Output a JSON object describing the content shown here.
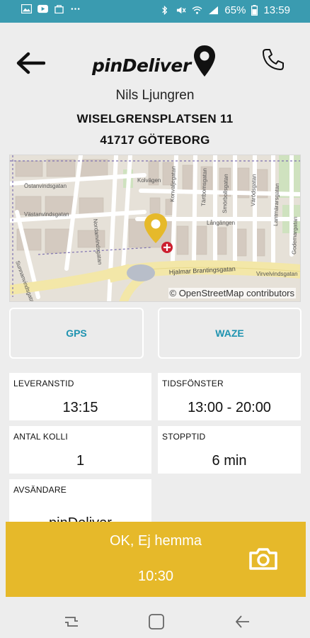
{
  "status_bar": {
    "battery": "65%",
    "time": "13:59",
    "background_color": "#3a9bb0",
    "left_icons": [
      "gallery-icon",
      "youtube-icon",
      "shopping-bag-icon",
      "more-dots-icon"
    ],
    "right_icons": [
      "bluetooth-icon",
      "mute-icon",
      "wifi-icon",
      "signal-icon",
      "battery-icon"
    ]
  },
  "header": {
    "back_icon": "arrow-left-icon",
    "logo_text": "pinDeliver",
    "logo_icon": "map-pin-icon",
    "call_icon": "phone-icon"
  },
  "customer": {
    "name": "Nils Ljungren",
    "street": "WISELGRENSPLATSEN 11",
    "city": "41717 GÖTEBORG"
  },
  "map": {
    "attribution": "© OpenStreetMap contributors",
    "street_labels": [
      "Östanvindsgatan",
      "Västanvindsgatan",
      "Sunnanvindsgatan",
      "Nordanvindsgatan",
      "Kolvägen",
      "Konvaljegatan",
      "Tärtbomsgatan",
      "Smörbollsgatan",
      "Värödsgatan",
      "Långängen",
      "Lantmärarsgatan",
      "Godemargatan",
      "Hjalmar Brantingsgatan",
      "Virvelvindsgatan"
    ],
    "marker_color": "#e6b92a",
    "accent_color": "#cc1f2f"
  },
  "navigation": {
    "gps_label": "GPS",
    "waze_label": "WAZE",
    "accent_color": "#1e93b0"
  },
  "info": {
    "leveranstid_label": "LEVERANSTID",
    "leveranstid_value": "13:15",
    "tidsfonster_label": "TIDSFÖNSTER",
    "tidsfonster_value": "13:00 - 20:00",
    "antal_kolli_label": "ANTAL KOLLI",
    "antal_kolli_value": "1",
    "stopptid_label": "STOPPTID",
    "stopptid_value": "6 min",
    "avsandare_label": "AVSÄNDARE",
    "avsandare_value": "pinDeliver"
  },
  "action": {
    "label": "OK, Ej hemma",
    "time": "10:30",
    "icon": "camera-icon",
    "color": "#e6b92a"
  },
  "android_nav": {
    "icons": [
      "recents-icon",
      "home-icon",
      "back-icon"
    ]
  }
}
